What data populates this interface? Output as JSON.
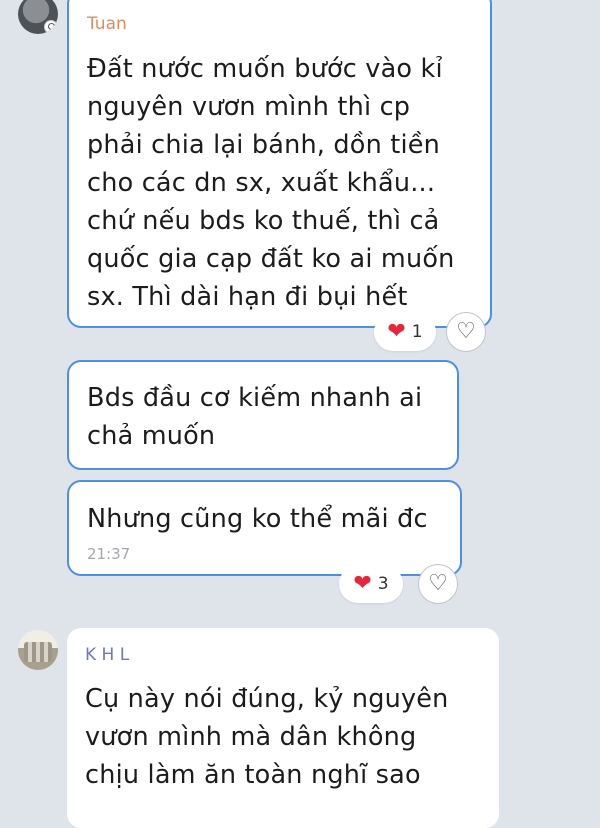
{
  "messages": [
    {
      "sender": "Tuan",
      "sender_color": "#e08a5e",
      "lines": [
        "Đất nước muốn bước vào kỉ",
        "nguyên vươn mình thì cp",
        "phải chia lại bánh, dồn tiền",
        "cho các dn sx, xuất khẩu...",
        "chứ nếu bds ko thuế, thì cả",
        "quốc gia cạp đất ko ai muốn",
        "sx. Thì dài hạn đi bụi hết"
      ],
      "reaction_count": "1"
    },
    {
      "lines": [
        "Bds đầu cơ kiếm nhanh ai",
        "chả muốn"
      ]
    },
    {
      "lines": [
        "Nhưng cũng ko thể mãi đc"
      ],
      "time": "21:37",
      "reaction_count": "3"
    },
    {
      "sender": "K H L",
      "sender_color": "#6a78d1",
      "lines": [
        "Cụ này nói đúng, kỷ nguyên",
        "vươn mình mà dân không",
        "chịu làm ăn toàn nghĩ sao"
      ]
    }
  ],
  "icons": {
    "heart": "❤",
    "react": "♡"
  },
  "colors": {
    "background": "#dfe4ea",
    "bubble_border": "#4d8ee8",
    "heart": "#e8253a"
  }
}
